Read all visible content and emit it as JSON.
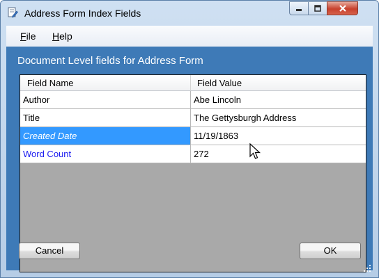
{
  "window": {
    "title": "Address Form Index Fields"
  },
  "menu": [
    {
      "access_key": "F",
      "rest": "ile"
    },
    {
      "access_key": "H",
      "rest": "elp"
    }
  ],
  "panel": {
    "heading": "Document Level fields for Address Form"
  },
  "grid": {
    "columns": [
      "Field Name",
      "Field Value"
    ],
    "rows": [
      {
        "name": "Author",
        "value": "Abe Lincoln"
      },
      {
        "name": "Title",
        "value": "The Gettysburgh Address"
      },
      {
        "name": "Created Date",
        "value": "11/19/1863",
        "selected": true
      },
      {
        "name": "Word Count",
        "value": "272"
      }
    ]
  },
  "buttons": {
    "cancel": "Cancel",
    "ok": "OK"
  },
  "colors": {
    "panel": "#3e7ab7",
    "selection": "#3399ff",
    "link_text": "#1a1af0"
  },
  "icons": [
    "document-edit-icon",
    "minimize-icon",
    "maximize-icon",
    "close-icon",
    "mouse-pointer-icon",
    "resize-grip-icon"
  ]
}
